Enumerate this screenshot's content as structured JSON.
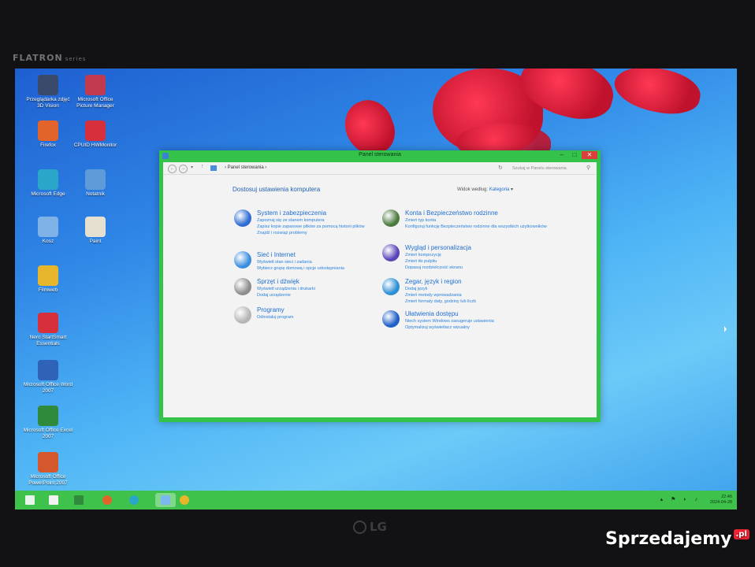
{
  "monitor": {
    "brand": "FLATRON",
    "series": "series",
    "maker": "LG"
  },
  "watermark": {
    "text": "Sprzedajemy",
    "suffix": ".pl"
  },
  "desktop_icons": [
    {
      "label": "Przeglądarka zdjęć 3D Vision",
      "icon": "3d-vision-icon",
      "color": "#3a4a6a"
    },
    {
      "label": "Microsoft Office Picture Manager",
      "icon": "picture-manager-icon",
      "color": "#c23a4e"
    },
    {
      "label": "Firefox",
      "icon": "firefox-icon",
      "color": "#e2642a"
    },
    {
      "label": "CPUID HWMonitor",
      "icon": "hwmonitor-icon",
      "color": "#d5303c"
    },
    {
      "label": "Microsoft Edge",
      "icon": "edge-icon",
      "color": "#2aa6c9"
    },
    {
      "label": "Notatnik",
      "icon": "notepad-icon",
      "color": "#5e9bd8"
    },
    {
      "label": "Kosz",
      "icon": "recycle-bin-icon",
      "color": "#7fb3e8"
    },
    {
      "label": "Paint",
      "icon": "paint-icon",
      "color": "#e6e0d0"
    },
    {
      "label": "Filmweb",
      "icon": "filmweb-icon",
      "color": "#e8b62a"
    },
    {
      "label": "Nero StartSmart Essentials",
      "icon": "nero-icon",
      "color": "#d6303c"
    },
    {
      "label": "Microsoft Office Word 2007",
      "icon": "word-icon",
      "color": "#2f63b8"
    },
    {
      "label": "Microsoft Office Excel 2007",
      "icon": "excel-icon",
      "color": "#2f8a3c"
    },
    {
      "label": "Microsoft Office PowerPoint 2007",
      "icon": "powerpoint-icon",
      "color": "#d5572c"
    }
  ],
  "window": {
    "title": "Panel sterowania",
    "breadcrumb": "Panel sterowania",
    "search_placeholder": "Szukaj w Panelu sterowania",
    "heading": "Dostosuj ustawienia komputera",
    "view_by_label": "Widok według:",
    "view_by_value": "Kategoria",
    "categories_left": [
      {
        "title": "System i zabezpieczenia",
        "icon": "shield-icon",
        "color": "#2e6cd1",
        "links": [
          "Zapoznaj się ze stanem komputera",
          "Zapisz kopie zapasowe plików za pomocą historii plików",
          "Znajdź i rozwiąż problemy"
        ]
      },
      {
        "title": "Sieć i Internet",
        "icon": "network-icon",
        "color": "#3b8ede",
        "links": [
          "Wyświetl stan sieci i zadania",
          "Wybierz grupę domową i opcje udostępniania"
        ]
      },
      {
        "title": "Sprzęt i dźwięk",
        "icon": "printer-icon",
        "color": "#8d8d8d",
        "links": [
          "Wyświetl urządzenia i drukarki",
          "Dodaj urządzenie"
        ]
      },
      {
        "title": "Programy",
        "icon": "programs-icon",
        "color": "#b5b5b5",
        "links": [
          "Odinstaluj program"
        ]
      }
    ],
    "categories_right": [
      {
        "title": "Konta i Bezpieczeństwo rodzinne",
        "icon": "users-icon",
        "color": "#4c7a3d",
        "links": [
          "Zmień typ konta",
          "Konfiguruj funkcję Bezpieczeństwo rodzinne dla wszystkich użytkowników"
        ]
      },
      {
        "title": "Wygląd i personalizacja",
        "icon": "appearance-icon",
        "color": "#5a43b8",
        "links": [
          "Zmień kompozycję",
          "Zmień tło pulpitu",
          "Dopasuj rozdzielczość ekranu"
        ]
      },
      {
        "title": "Zegar, język i region",
        "icon": "globe-clock-icon",
        "color": "#2b8fd6",
        "links": [
          "Dodaj język",
          "Zmień metody wprowadzania",
          "Zmień formaty daty, godziny lub liczb"
        ]
      },
      {
        "title": "Ułatwienia dostępu",
        "icon": "accessibility-icon",
        "color": "#1d5ec7",
        "links": [
          "Niech system Windows zasugeruje ustawienia",
          "Optymalizuj wyświetlacz wizualny"
        ]
      }
    ]
  },
  "taskbar": {
    "items": [
      {
        "name": "start-button",
        "icon": "windows-icon",
        "color": "#e8f5ea"
      },
      {
        "name": "file-explorer-button",
        "icon": "folder-icon",
        "color": "#f2f2f2"
      },
      {
        "name": "store-button",
        "icon": "store-icon",
        "color": "#2f8a3c"
      },
      {
        "name": "firefox-taskbar-button",
        "icon": "firefox-icon",
        "color": "#e2642a"
      },
      {
        "name": "edge-taskbar-button",
        "icon": "edge-icon",
        "color": "#2aa6c9"
      },
      {
        "name": "control-panel-taskbar-button",
        "icon": "control-panel-icon",
        "color": "#7ab8ee"
      },
      {
        "name": "filmweb-taskbar-button",
        "icon": "filmweb-icon",
        "color": "#e8b62a"
      }
    ],
    "time": "22:46",
    "date": "2024-04-28"
  }
}
